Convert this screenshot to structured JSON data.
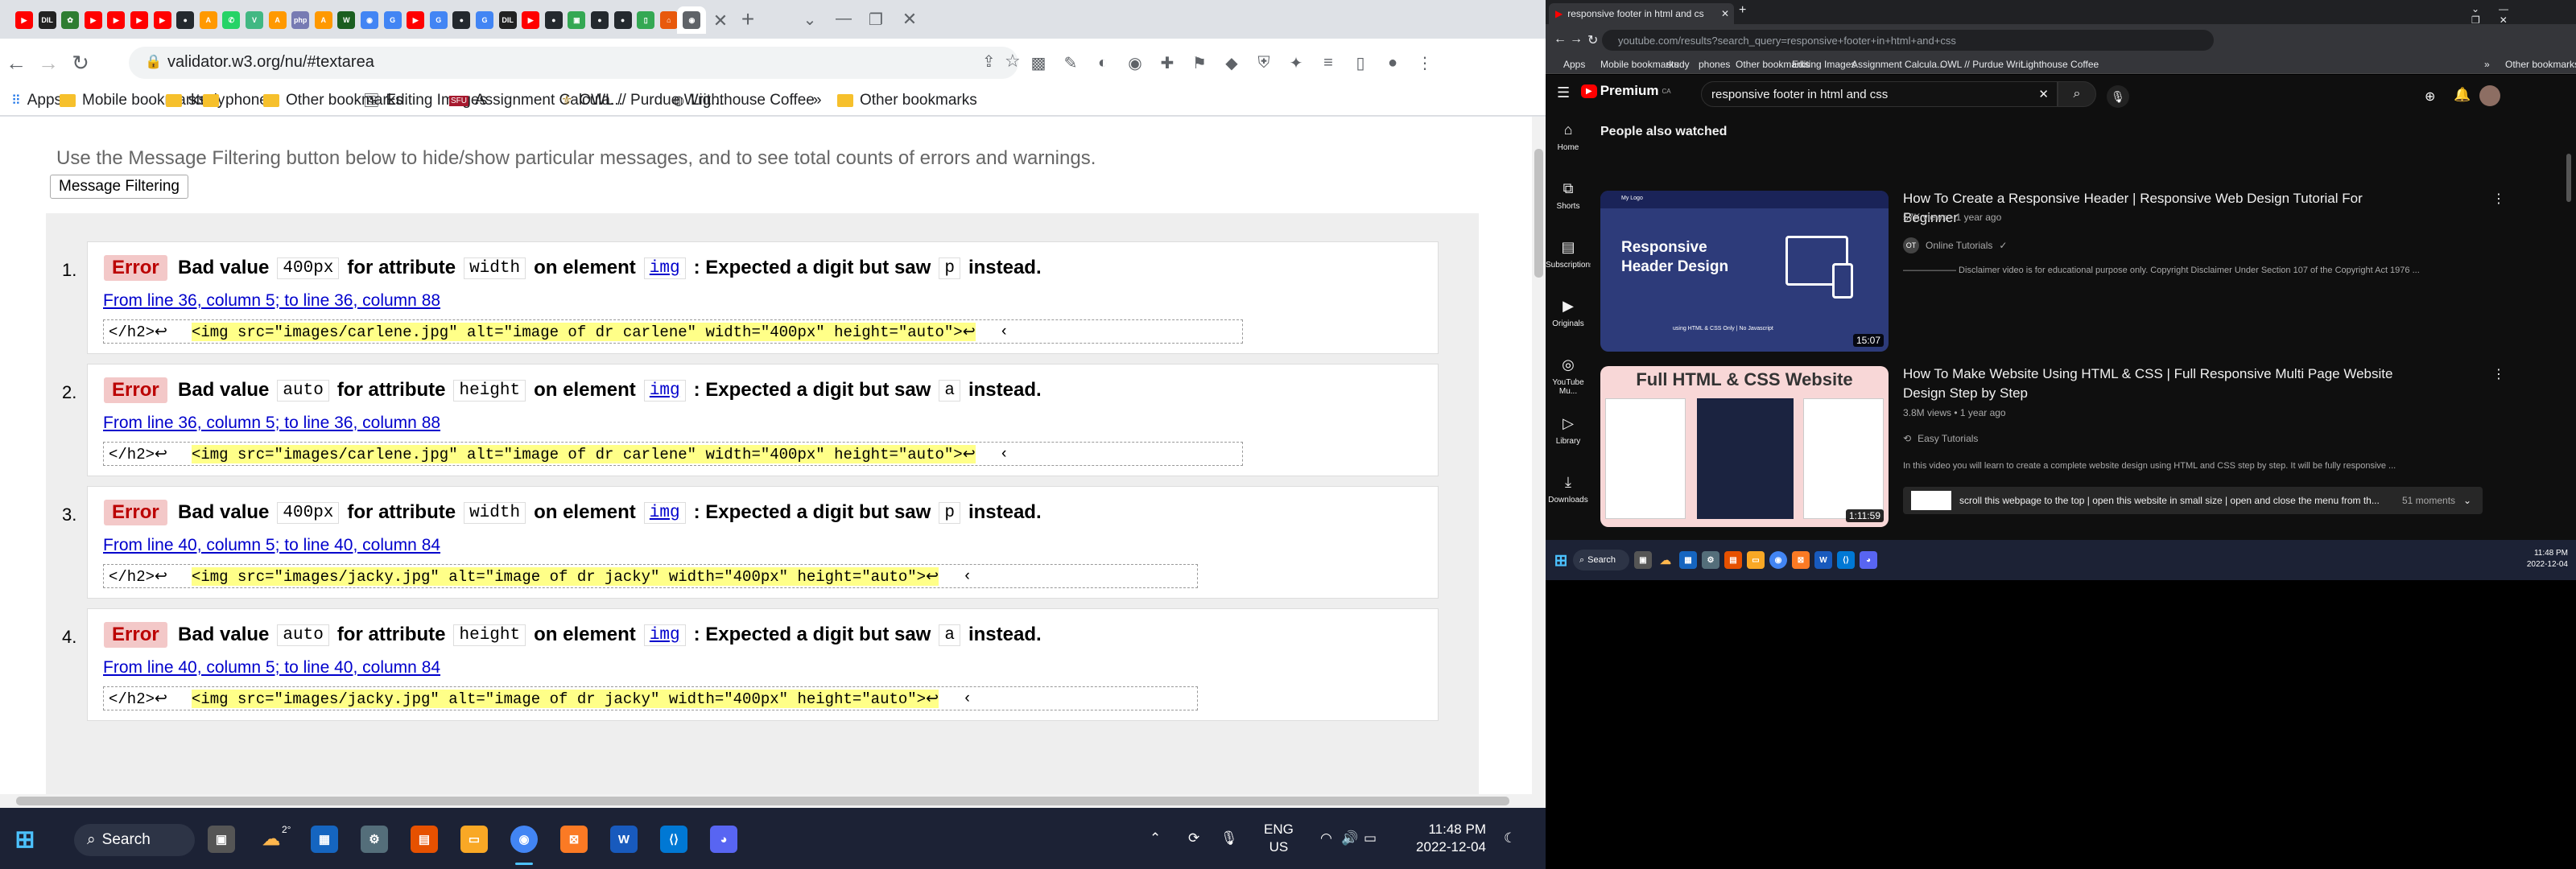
{
  "left": {
    "tabs": [
      {
        "icon": "youtube-icon",
        "color": "#ff0000",
        "text": "▶"
      },
      {
        "icon": "dil-icon",
        "color": "#222222",
        "text": "DIL"
      },
      {
        "icon": "leaf-icon",
        "color": "#2e7d32",
        "text": "✿"
      },
      {
        "icon": "youtube-icon",
        "color": "#ff0000",
        "text": "▶"
      },
      {
        "icon": "youtube-icon",
        "color": "#ff0000",
        "text": "▶"
      },
      {
        "icon": "youtube-icon",
        "color": "#ff0000",
        "text": "▶"
      },
      {
        "icon": "youtube-icon",
        "color": "#ff0000",
        "text": "▶"
      },
      {
        "icon": "github-icon",
        "color": "#24292e",
        "text": "●"
      },
      {
        "icon": "amazon-icon",
        "color": "#ff9900",
        "text": "A"
      },
      {
        "icon": "whatsapp-icon",
        "color": "#25d366",
        "text": "✆"
      },
      {
        "icon": "vue-icon",
        "color": "#41b883",
        "text": "V"
      },
      {
        "icon": "amazon-icon",
        "color": "#ff9900",
        "text": "A"
      },
      {
        "icon": "php-icon",
        "color": "#777bb3",
        "text": "php"
      },
      {
        "icon": "amazon-icon",
        "color": "#ff9900",
        "text": "A"
      },
      {
        "icon": "w-icon",
        "color": "#1b5e20",
        "text": "W"
      },
      {
        "icon": "chrome-icon",
        "color": "#4285f4",
        "text": "◉"
      },
      {
        "icon": "google-icon",
        "color": "#4285f4",
        "text": "G"
      },
      {
        "icon": "youtube-icon",
        "color": "#ff0000",
        "text": "▶"
      },
      {
        "icon": "google-icon",
        "color": "#4285f4",
        "text": "G"
      },
      {
        "icon": "github-icon",
        "color": "#24292e",
        "text": "●"
      },
      {
        "icon": "google-icon",
        "color": "#4285f4",
        "text": "G"
      },
      {
        "icon": "dil-icon",
        "color": "#222222",
        "text": "DIL"
      },
      {
        "icon": "youtube-icon",
        "color": "#ff0000",
        "text": "▶"
      },
      {
        "icon": "github-icon",
        "color": "#24292e",
        "text": "●"
      },
      {
        "icon": "docs-icon",
        "color": "#34a853",
        "text": "▣"
      },
      {
        "icon": "github-icon",
        "color": "#24292e",
        "text": "●"
      },
      {
        "icon": "github-icon",
        "color": "#24292e",
        "text": "●"
      },
      {
        "icon": "keep-icon",
        "color": "#34a853",
        "text": "▯"
      },
      {
        "icon": "app-icon",
        "color": "#e8590c",
        "text": "⌂"
      },
      {
        "icon": "w3c-icon",
        "color": "#5f6368",
        "text": "◉"
      }
    ],
    "url": "validator.w3.org/nu/#textarea",
    "bookmarks": {
      "apps": "Apps",
      "items": [
        "Mobile bookmarks",
        "study",
        "phones",
        "Other bookmarks",
        "Editing Images",
        "Assignment Calcula...",
        "OWL // Purdue Writ...",
        "Lighthouse Coffee"
      ],
      "overflow": "»",
      "other": "Other bookmarks"
    },
    "page": {
      "intro": "Use the Message Filtering button below to hide/show particular messages, and to see total counts of errors and warnings.",
      "filter_button": "Message Filtering",
      "messages": [
        {
          "num": "1.",
          "type": "Error",
          "pre": "Bad value",
          "value": "400px",
          "mid": "for attribute",
          "attr": "width",
          "on": "on element",
          "element": "img",
          "post": ": Expected a digit but saw",
          "saw": "p",
          "end": "instead.",
          "location": "From line 36, column 5; to line 36, column 88",
          "ext_pre": "</h2>↩",
          "ext_hl": "<img src=\"images/carlene.jpg\" alt=\"image of dr carlene\" width=\"400px\" height=\"auto\">↩",
          "ext_post": "‹"
        },
        {
          "num": "2.",
          "type": "Error",
          "pre": "Bad value",
          "value": "auto",
          "mid": "for attribute",
          "attr": "height",
          "on": "on element",
          "element": "img",
          "post": ": Expected a digit but saw",
          "saw": "a",
          "end": "instead.",
          "location": "From line 36, column 5; to line 36, column 88",
          "ext_pre": "</h2>↩",
          "ext_hl": "<img src=\"images/carlene.jpg\" alt=\"image of dr carlene\" width=\"400px\" height=\"auto\">↩",
          "ext_post": "‹"
        },
        {
          "num": "3.",
          "type": "Error",
          "pre": "Bad value",
          "value": "400px",
          "mid": "for attribute",
          "attr": "width",
          "on": "on element",
          "element": "img",
          "post": ": Expected a digit but saw",
          "saw": "p",
          "end": "instead.",
          "location": "From line 40, column 5; to line 40, column 84",
          "ext_pre": "</h2>↩",
          "ext_hl": "<img src=\"images/jacky.jpg\" alt=\"image of dr jacky\" width=\"400px\" height=\"auto\">↩",
          "ext_post": "‹"
        },
        {
          "num": "4.",
          "type": "Error",
          "pre": "Bad value",
          "value": "auto",
          "mid": "for attribute",
          "attr": "height",
          "on": "on element",
          "element": "img",
          "post": ": Expected a digit but saw",
          "saw": "a",
          "end": "instead.",
          "location": "From line 40, column 5; to line 40, column 84",
          "ext_pre": "</h2>↩",
          "ext_hl": "<img src=\"images/jacky.jpg\" alt=\"image of dr jacky\" width=\"400px\" height=\"auto\">↩",
          "ext_post": "‹"
        }
      ]
    },
    "taskbar": {
      "search": "Search",
      "weather": "2°",
      "lang1": "ENG",
      "lang2": "US",
      "time": "11:48 PM",
      "date": "2022-12-04"
    }
  },
  "right": {
    "tab_title": "responsive footer in html and cs",
    "url": "youtube.com/results?search_query=responsive+footer+in+html+and+css",
    "bookmarks": [
      "Apps",
      "Mobile bookmarks",
      "study",
      "phones",
      "Other bookmarks",
      "Editing Images",
      "Assignment Calcula...",
      "OWL // Purdue Writ...",
      "Lighthouse Coffee",
      "»",
      "Other bookmarks"
    ],
    "logo": "Premium",
    "logo_sup": "CA",
    "search_query": "responsive footer in html and css",
    "sidebar": [
      "Home",
      "Shorts",
      "Subscriptions",
      "Originals",
      "YouTube Mu...",
      "Library",
      "Downloads"
    ],
    "section_title": "People also watched",
    "videos": [
      {
        "title": "How To Create a Responsive Header | Responsive Web Design Tutorial For Beginner",
        "meta": "57K views • 1 year ago",
        "channel": "Online Tutorials",
        "channel_initials": "OT",
        "desc": "—————— Disclaimer video is for educational purpose only. Copyright Disclaimer Under Section 107 of the Copyright Act 1976 ...",
        "duration": "15:07",
        "thumb_title1": "Responsive",
        "thumb_title2": "Header Design",
        "thumb_logo": "My Logo",
        "thumb_caption": "using HTML & CSS Only | No Javascript"
      },
      {
        "title": "How To Make Website Using HTML & CSS | Full Responsive Multi Page Website Design Step by Step",
        "meta": "3.8M views • 1 year ago",
        "channel": "Easy Tutorials",
        "desc": "In this video you will learn to create a complete website design using HTML and CSS step by step. It will be fully responsive ...",
        "duration": "1:11:59",
        "thumb_title": "Full HTML & CSS Website",
        "chapter": "scroll this webpage to the top | open this website in small size | open and close the menu from th...",
        "chapter_count": "51 moments"
      }
    ],
    "taskbar": {
      "search": "Search",
      "time": "11:48 PM",
      "date": "2022-12-04"
    }
  }
}
